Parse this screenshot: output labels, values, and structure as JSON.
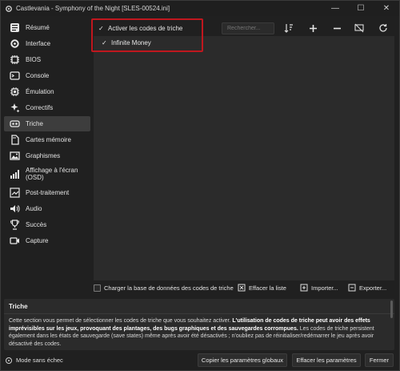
{
  "window": {
    "title": "Castlevania - Symphony of the Night [SLES-00524.ini]",
    "controls": {
      "minimize": "—",
      "maximize": "☐",
      "close": "✕"
    }
  },
  "sidebar": {
    "items": [
      {
        "label": "Résumé",
        "icon": "summary-icon"
      },
      {
        "label": "Interface",
        "icon": "interface-icon"
      },
      {
        "label": "BIOS",
        "icon": "chip-icon"
      },
      {
        "label": "Console",
        "icon": "console-icon"
      },
      {
        "label": "Émulation",
        "icon": "emulation-icon"
      },
      {
        "label": "Correctifs",
        "icon": "sparkle-icon"
      },
      {
        "label": "Triche",
        "icon": "cheat-icon",
        "active": true
      },
      {
        "label": "Cartes mémoire",
        "icon": "memory-card-icon"
      },
      {
        "label": "Graphismes",
        "icon": "image-icon"
      },
      {
        "label": "Affichage à l'écran (OSD)",
        "icon": "osd-icon"
      },
      {
        "label": "Post-traitement",
        "icon": "post-processing-icon"
      },
      {
        "label": "Audio",
        "icon": "speaker-icon"
      },
      {
        "label": "Succès",
        "icon": "trophy-icon"
      },
      {
        "label": "Capture",
        "icon": "camera-icon"
      }
    ]
  },
  "cheats": {
    "enable_label": "Activer les codes de triche",
    "enable_checked": true,
    "search_placeholder": "Rechercher...",
    "items": [
      {
        "label": "Infinite Money",
        "checked": true
      }
    ],
    "bottom": {
      "load_db_label": "Charger la base de données des codes de triche",
      "clear_label": "Effacer la liste",
      "import_label": "Importer...",
      "export_label": "Exporter..."
    }
  },
  "description": {
    "title": "Triche",
    "text_1": "Cette section vous permet de sélectionner les codes de triche que vous souhaitez activer. ",
    "text_bold": "L'utilisation de codes de triche peut avoir des effets imprévisibles sur les jeux, provoquant des plantages, des bugs graphiques et des sauvegardes corrompues.",
    "text_2": " Les codes de triche persistent également dans les états de sauvegarde (save states) même après avoir été désactivés ; n'oubliez pas de réinitialiser/redémarrer le jeu après avoir désactivé des codes."
  },
  "footer": {
    "mode_label": "Mode sans échec",
    "copy_global_label": "Copier les paramètres globaux",
    "clear_settings_label": "Effacer les paramètres",
    "close_label": "Fermer"
  },
  "colors": {
    "background": "#202020",
    "panel": "#2b2b2b",
    "highlight_box": "#c0171e",
    "active_item": "#3d3d3d"
  }
}
